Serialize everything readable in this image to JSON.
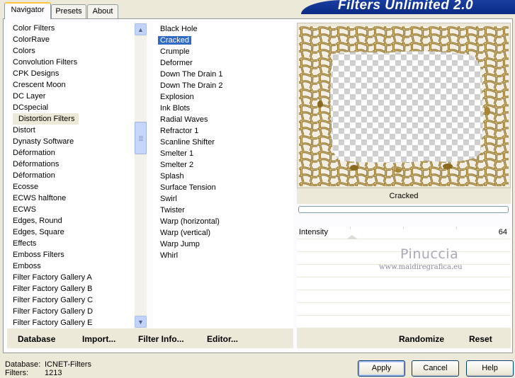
{
  "tabs": [
    {
      "label": "Navigator",
      "active": true
    },
    {
      "label": "Presets",
      "active": false
    },
    {
      "label": "About",
      "active": false
    }
  ],
  "banner": {
    "title": "Filters Unlimited 2.0"
  },
  "categories": [
    "Color Filters",
    "ColorRave",
    "Colors",
    "Convolution Filters",
    "CPK Designs",
    "Crescent Moon",
    "DC Layer",
    "DCspecial",
    "Distortion Filters",
    "Distort",
    "Dynasty Software",
    "Déformation",
    "Déformations",
    "Déformation",
    "Ecosse",
    "ECWS halftone",
    "ECWS",
    "Edges, Round",
    "Edges, Square",
    "Effects",
    "Emboss Filters",
    "Emboss",
    "Filter Factory Gallery A",
    "Filter Factory Gallery B",
    "Filter Factory Gallery C",
    "Filter Factory Gallery D",
    "Filter Factory Gallery E"
  ],
  "selected_category": "Distortion Filters",
  "filters": [
    "Black Hole",
    "Cracked",
    "Crumple",
    "Deformer",
    "Down The Drain 1",
    "Down The Drain 2",
    "Explosion",
    "Ink Blots",
    "Radial Waves",
    "Refractor 1",
    "Scanline Shifter",
    "Smelter 1",
    "Smelter 2",
    "Splash",
    "Surface Tension",
    "Swirl",
    "Twister",
    "Warp (horizontal)",
    "Warp (vertical)",
    "Warp Jump",
    "Whirl"
  ],
  "selected_filter": "Cracked",
  "preview": {
    "filter_name": "Cracked",
    "crack_color": "#8a6a20"
  },
  "params": [
    {
      "label": "Intensity",
      "value": "64"
    }
  ],
  "watermark": {
    "name": "Pinuccia",
    "url": "www.maidiregrafica.eu"
  },
  "left_buttons": {
    "database": "Database",
    "import": "Import...",
    "filter_info": "Filter Info...",
    "editor": "Editor..."
  },
  "right_buttons": {
    "randomize": "Randomize",
    "reset": "Reset"
  },
  "footer": {
    "database_label": "Database:",
    "database_value": "ICNET-Filters",
    "filters_label": "Filters:",
    "filters_value": "1213"
  },
  "dialog_buttons": {
    "apply": "Apply",
    "cancel": "Cancel",
    "help": "Help"
  },
  "icons": {
    "scroll_up": "chevron-up-icon",
    "scroll_down": "chevron-down-icon"
  }
}
